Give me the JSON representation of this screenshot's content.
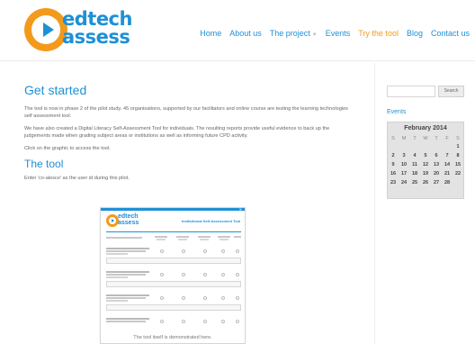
{
  "brand": {
    "line1": "edtech",
    "line2": "assess"
  },
  "nav": [
    {
      "label": "Home",
      "active": false
    },
    {
      "label": "About us",
      "active": false
    },
    {
      "label": "The project",
      "active": false,
      "has_dropdown": true
    },
    {
      "label": "Events",
      "active": false
    },
    {
      "label": "Try the tool",
      "active": true
    },
    {
      "label": "Blog",
      "active": false
    },
    {
      "label": "Contact us",
      "active": false
    }
  ],
  "main": {
    "title": "Get started",
    "para1": "The tool is now in phase 2 of the pilot study. 45 organisations, supported by our facilitators and online course are testing the learning technologies self assessment tool.",
    "para2": "We have also created a Digital Literacy Self-Assessment Tool for individuals. The resulting reports provide useful evidence to back up the judgements made when grading subject areas or institutions as well as informing future CPD activity.",
    "para3": "Click on the graphic to access the tool.",
    "subtitle": "The tool",
    "instruction": "Enter 'co-alesce' as the user id during this pilot.",
    "preview": {
      "brand1": "edtech",
      "brand2": "assess",
      "title": "Institutional Self-Assessment Tool",
      "caption": "The tool itself is demonstrated here."
    }
  },
  "sidebar": {
    "search_placeholder": "",
    "search_button": "Search",
    "events_title": "Events",
    "calendar": {
      "month": "February 2014",
      "weekdays": [
        "S",
        "M",
        "T",
        "W",
        "T",
        "F",
        "S"
      ],
      "weeks": [
        [
          "",
          "",
          "",
          "",
          "",
          "",
          "1"
        ],
        [
          "2",
          "3",
          "4",
          "5",
          "6",
          "7",
          "8"
        ],
        [
          "9",
          "10",
          "11",
          "12",
          "13",
          "14",
          "15"
        ],
        [
          "16",
          "17",
          "18",
          "19",
          "20",
          "21",
          "22"
        ],
        [
          "23",
          "24",
          "25",
          "26",
          "27",
          "28",
          ""
        ]
      ]
    }
  },
  "colors": {
    "accent_blue": "#1e90d6",
    "accent_orange": "#f39a1c"
  }
}
